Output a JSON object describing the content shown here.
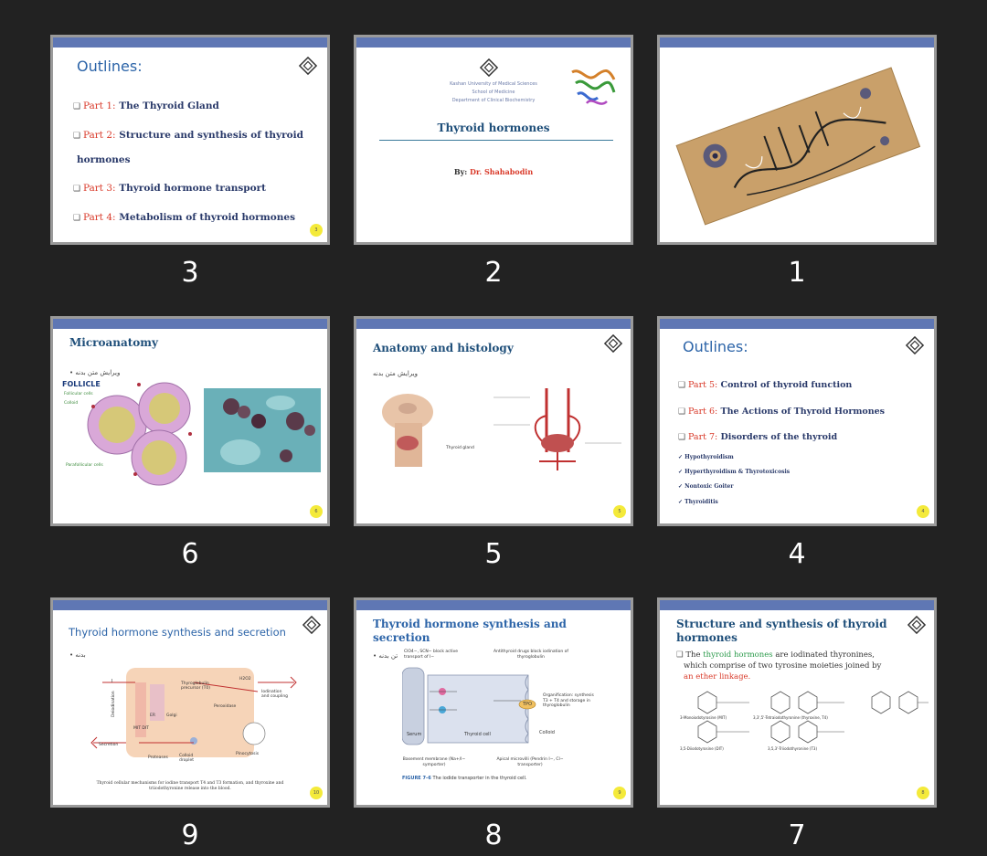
{
  "slides": [
    {
      "number": "3",
      "page_badge": "3",
      "title": "Outlines:",
      "items": [
        {
          "prefix": "Part 1:",
          "text": "The Thyroid Gland"
        },
        {
          "prefix": "Part 2:",
          "text": "Structure and synthesis of thyroid"
        },
        {
          "prefix": "",
          "text": "hormones"
        },
        {
          "prefix": "Part 3:",
          "text": "Thyroid hormone transport"
        },
        {
          "prefix": "Part 4:",
          "text": "Metabolism of thyroid hormones"
        }
      ]
    },
    {
      "number": "2",
      "university": "Kashan University of Medical Sciences",
      "school": "School of Medicine",
      "department": "Department of Clinical Biochemistry",
      "title": "Thyroid hormones",
      "by_label": "By:",
      "author": "Dr. Shahabodin"
    },
    {
      "number": "1"
    },
    {
      "number": "6",
      "page_badge": "6",
      "title": "Microanatomy",
      "edit_note": "ویرایش متن بدنه",
      "follicle_label": "FOLLICLE",
      "labels": [
        "Follicular cells",
        "Colloid",
        "Parafollicular cells"
      ]
    },
    {
      "number": "5",
      "page_badge": "5",
      "title": "Anatomy and histology",
      "edit_note": "ویرایش متن بدنه",
      "gland_label": "Thyroid gland"
    },
    {
      "number": "4",
      "page_badge": "4",
      "title": "Outlines:",
      "items": [
        {
          "prefix": "Part 5:",
          "text": "Control of thyroid function"
        },
        {
          "prefix": "Part 6:",
          "text": "The Actions of Thyroid Hormones"
        },
        {
          "prefix": "Part 7:",
          "text": "Disorders of the thyroid"
        }
      ],
      "subitems": [
        "Hypothyroidism",
        "Hyperthyroidism & Thyrotoxicosis",
        "Nontoxic Goiter",
        "Thyroiditis"
      ]
    },
    {
      "number": "9",
      "page_badge": "10",
      "title": "Thyroid hormone synthesis and secretion",
      "edit_note": "بدنه",
      "labels": {
        "thyroglobulin": "Thyroglobulin precursor (T0)",
        "peroxidase": "Peroxidase",
        "h2o2": "H2O2",
        "iodination": "Iodination and coupling",
        "er": "ER",
        "golgi": "Golgi",
        "mitdit": "MIT DIT",
        "secretion": "Secretion",
        "proteases": "Proteases",
        "colloid": "Colloid droplet",
        "pinocytosis": "Pinocytosis",
        "deiodination": "Deiodination",
        "iodide": "I"
      },
      "caption": "Thyroid cellular mechanisms for iodine transport T4 and T3 formation, and thyroxine and triiodothyronine release into the blood."
    },
    {
      "number": "8",
      "page_badge": "9",
      "title": "Thyroid hormone synthesis and secretion",
      "edit_note": "تن بدنه",
      "labels": {
        "block1": "ClO4−, SCN− block active transport of I−",
        "block2": "Antithyroid drugs block iodination of thyroglobulin",
        "organification": "Organification: synthesis T3 + T4 and storage in thyroglobulin",
        "tpo": "TPO",
        "colloid": "Colloid",
        "serum": "Serum",
        "cell": "Thyroid cell",
        "basement": "Basement membrane (Na+/I− symporter)",
        "apical": "Apical microvilli (Pendrin I−, Cl− transporter)"
      },
      "figure_label": "FIGURE 7–6",
      "figure_caption": "The iodide transporter in the thyroid cell."
    },
    {
      "number": "7",
      "page_badge": "8",
      "title": "Structure and synthesis of thyroid hormones",
      "line1_a": "The",
      "line1_highlight": "thyroid hormones",
      "line1_b": "are iodinated thyronines,",
      "line2": "which comprise of two tyrosine moieties joined by",
      "line3": "an ether linkage.",
      "compounds": [
        "3-Monoiodotyrosine (MIT)",
        "3,3',5'-Tetraiodothyronine (thyroxine, T4)",
        "3,5-Diiodotyrosine (DIT)",
        "3,5,3'-Triiodothyronine (T3)"
      ]
    }
  ],
  "colors": {
    "header_bar": "#5f77b4",
    "title_blue": "#2c64a8",
    "accent_red": "#d93a2a",
    "badge": "#f4ea3a",
    "highlight_green": "#2a9a4a"
  }
}
